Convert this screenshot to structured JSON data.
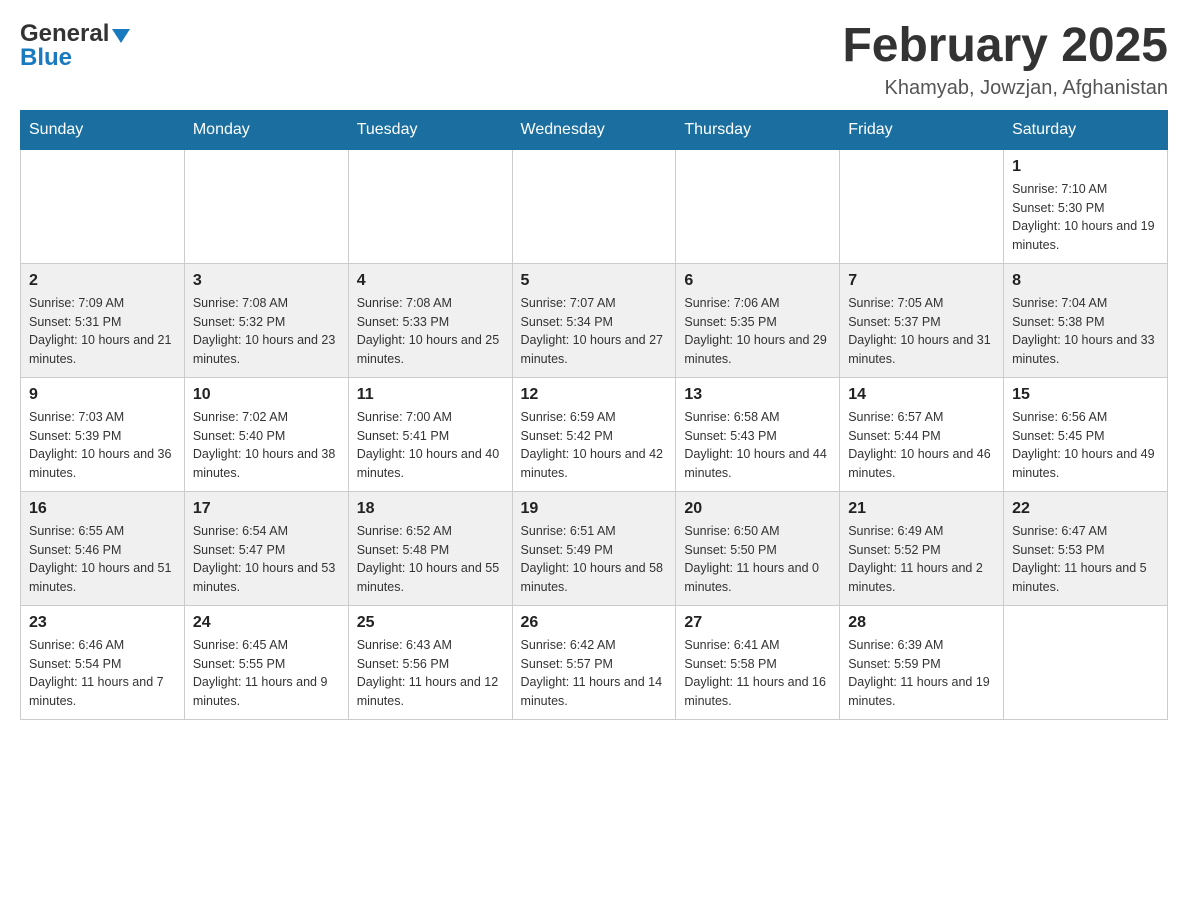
{
  "header": {
    "logo_general": "General",
    "logo_blue": "Blue",
    "month_title": "February 2025",
    "location": "Khamyab, Jowzjan, Afghanistan"
  },
  "weekdays": [
    "Sunday",
    "Monday",
    "Tuesday",
    "Wednesday",
    "Thursday",
    "Friday",
    "Saturday"
  ],
  "weeks": [
    [
      {
        "day": "",
        "sunrise": "",
        "sunset": "",
        "daylight": ""
      },
      {
        "day": "",
        "sunrise": "",
        "sunset": "",
        "daylight": ""
      },
      {
        "day": "",
        "sunrise": "",
        "sunset": "",
        "daylight": ""
      },
      {
        "day": "",
        "sunrise": "",
        "sunset": "",
        "daylight": ""
      },
      {
        "day": "",
        "sunrise": "",
        "sunset": "",
        "daylight": ""
      },
      {
        "day": "",
        "sunrise": "",
        "sunset": "",
        "daylight": ""
      },
      {
        "day": "1",
        "sunrise": "Sunrise: 7:10 AM",
        "sunset": "Sunset: 5:30 PM",
        "daylight": "Daylight: 10 hours and 19 minutes."
      }
    ],
    [
      {
        "day": "2",
        "sunrise": "Sunrise: 7:09 AM",
        "sunset": "Sunset: 5:31 PM",
        "daylight": "Daylight: 10 hours and 21 minutes."
      },
      {
        "day": "3",
        "sunrise": "Sunrise: 7:08 AM",
        "sunset": "Sunset: 5:32 PM",
        "daylight": "Daylight: 10 hours and 23 minutes."
      },
      {
        "day": "4",
        "sunrise": "Sunrise: 7:08 AM",
        "sunset": "Sunset: 5:33 PM",
        "daylight": "Daylight: 10 hours and 25 minutes."
      },
      {
        "day": "5",
        "sunrise": "Sunrise: 7:07 AM",
        "sunset": "Sunset: 5:34 PM",
        "daylight": "Daylight: 10 hours and 27 minutes."
      },
      {
        "day": "6",
        "sunrise": "Sunrise: 7:06 AM",
        "sunset": "Sunset: 5:35 PM",
        "daylight": "Daylight: 10 hours and 29 minutes."
      },
      {
        "day": "7",
        "sunrise": "Sunrise: 7:05 AM",
        "sunset": "Sunset: 5:37 PM",
        "daylight": "Daylight: 10 hours and 31 minutes."
      },
      {
        "day": "8",
        "sunrise": "Sunrise: 7:04 AM",
        "sunset": "Sunset: 5:38 PM",
        "daylight": "Daylight: 10 hours and 33 minutes."
      }
    ],
    [
      {
        "day": "9",
        "sunrise": "Sunrise: 7:03 AM",
        "sunset": "Sunset: 5:39 PM",
        "daylight": "Daylight: 10 hours and 36 minutes."
      },
      {
        "day": "10",
        "sunrise": "Sunrise: 7:02 AM",
        "sunset": "Sunset: 5:40 PM",
        "daylight": "Daylight: 10 hours and 38 minutes."
      },
      {
        "day": "11",
        "sunrise": "Sunrise: 7:00 AM",
        "sunset": "Sunset: 5:41 PM",
        "daylight": "Daylight: 10 hours and 40 minutes."
      },
      {
        "day": "12",
        "sunrise": "Sunrise: 6:59 AM",
        "sunset": "Sunset: 5:42 PM",
        "daylight": "Daylight: 10 hours and 42 minutes."
      },
      {
        "day": "13",
        "sunrise": "Sunrise: 6:58 AM",
        "sunset": "Sunset: 5:43 PM",
        "daylight": "Daylight: 10 hours and 44 minutes."
      },
      {
        "day": "14",
        "sunrise": "Sunrise: 6:57 AM",
        "sunset": "Sunset: 5:44 PM",
        "daylight": "Daylight: 10 hours and 46 minutes."
      },
      {
        "day": "15",
        "sunrise": "Sunrise: 6:56 AM",
        "sunset": "Sunset: 5:45 PM",
        "daylight": "Daylight: 10 hours and 49 minutes."
      }
    ],
    [
      {
        "day": "16",
        "sunrise": "Sunrise: 6:55 AM",
        "sunset": "Sunset: 5:46 PM",
        "daylight": "Daylight: 10 hours and 51 minutes."
      },
      {
        "day": "17",
        "sunrise": "Sunrise: 6:54 AM",
        "sunset": "Sunset: 5:47 PM",
        "daylight": "Daylight: 10 hours and 53 minutes."
      },
      {
        "day": "18",
        "sunrise": "Sunrise: 6:52 AM",
        "sunset": "Sunset: 5:48 PM",
        "daylight": "Daylight: 10 hours and 55 minutes."
      },
      {
        "day": "19",
        "sunrise": "Sunrise: 6:51 AM",
        "sunset": "Sunset: 5:49 PM",
        "daylight": "Daylight: 10 hours and 58 minutes."
      },
      {
        "day": "20",
        "sunrise": "Sunrise: 6:50 AM",
        "sunset": "Sunset: 5:50 PM",
        "daylight": "Daylight: 11 hours and 0 minutes."
      },
      {
        "day": "21",
        "sunrise": "Sunrise: 6:49 AM",
        "sunset": "Sunset: 5:52 PM",
        "daylight": "Daylight: 11 hours and 2 minutes."
      },
      {
        "day": "22",
        "sunrise": "Sunrise: 6:47 AM",
        "sunset": "Sunset: 5:53 PM",
        "daylight": "Daylight: 11 hours and 5 minutes."
      }
    ],
    [
      {
        "day": "23",
        "sunrise": "Sunrise: 6:46 AM",
        "sunset": "Sunset: 5:54 PM",
        "daylight": "Daylight: 11 hours and 7 minutes."
      },
      {
        "day": "24",
        "sunrise": "Sunrise: 6:45 AM",
        "sunset": "Sunset: 5:55 PM",
        "daylight": "Daylight: 11 hours and 9 minutes."
      },
      {
        "day": "25",
        "sunrise": "Sunrise: 6:43 AM",
        "sunset": "Sunset: 5:56 PM",
        "daylight": "Daylight: 11 hours and 12 minutes."
      },
      {
        "day": "26",
        "sunrise": "Sunrise: 6:42 AM",
        "sunset": "Sunset: 5:57 PM",
        "daylight": "Daylight: 11 hours and 14 minutes."
      },
      {
        "day": "27",
        "sunrise": "Sunrise: 6:41 AM",
        "sunset": "Sunset: 5:58 PM",
        "daylight": "Daylight: 11 hours and 16 minutes."
      },
      {
        "day": "28",
        "sunrise": "Sunrise: 6:39 AM",
        "sunset": "Sunset: 5:59 PM",
        "daylight": "Daylight: 11 hours and 19 minutes."
      },
      {
        "day": "",
        "sunrise": "",
        "sunset": "",
        "daylight": ""
      }
    ]
  ]
}
